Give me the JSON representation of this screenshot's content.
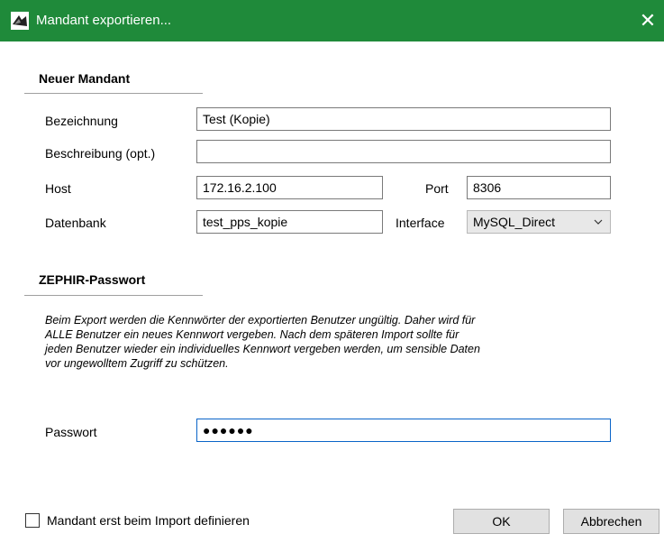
{
  "window": {
    "title": "Mandant exportieren...",
    "close_icon": "close-icon"
  },
  "new_client": {
    "heading": "Neuer Mandant",
    "name_label": "Bezeichnung",
    "name_value": "Test (Kopie)",
    "description_label": "Beschreibung (opt.)",
    "description_value": "",
    "host_label": "Host",
    "host_value": "172.16.2.100",
    "port_label": "Port",
    "port_value": "8306",
    "database_label": "Datenbank",
    "database_value": "test_pps_kopie",
    "interface_label": "Interface",
    "interface_value": "MySQL_Direct"
  },
  "zephir": {
    "heading": "ZEPHIR-Passwort",
    "hint_lines": [
      "Beim Export werden die Kennwörter der exportierten Benutzer ungültig. Daher wird für",
      "ALLE Benutzer ein neues Kennwort vergeben. Nach dem späteren Import sollte für",
      "jeden Benutzer wieder ein individuelles Kennwort vergeben werden, um sensible Daten",
      "vor ungewolltem Zugriff zu schützen."
    ],
    "password_label": "Passwort",
    "password_display": "●●●●●●"
  },
  "footer": {
    "checkbox_label": "Mandant erst beim Import definieren",
    "checkbox_checked": false,
    "ok_label": "OK",
    "cancel_label": "Abbrechen"
  },
  "colors": {
    "titlebar": "#1f8a3a",
    "focus_border": "#0a64c8"
  }
}
